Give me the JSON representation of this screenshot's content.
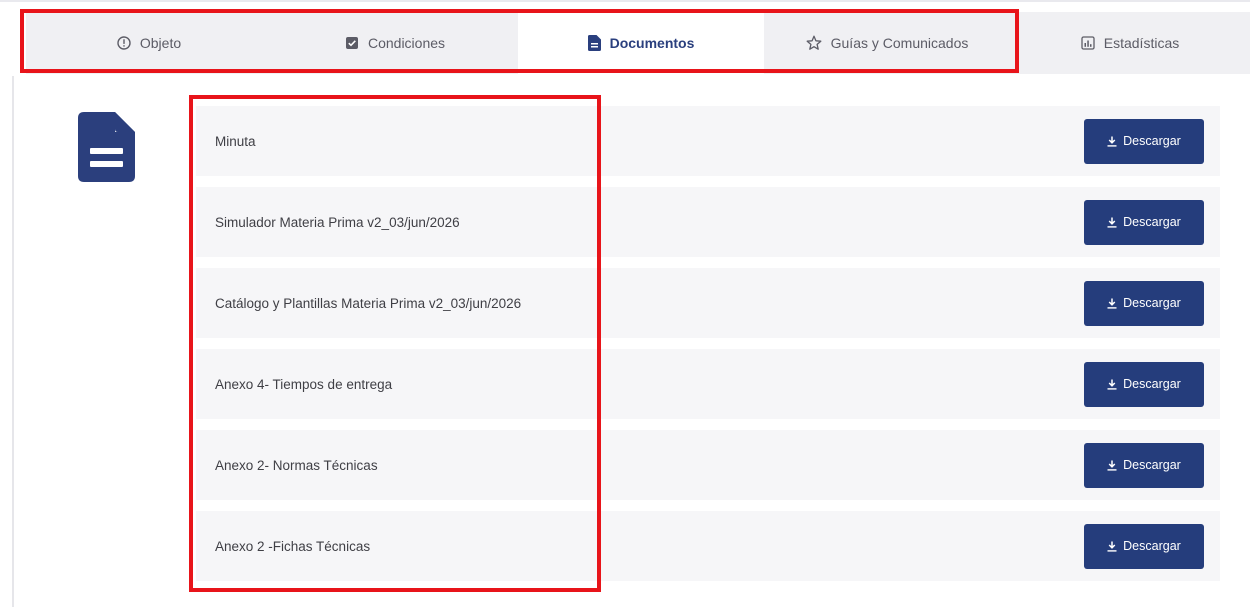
{
  "tabs": [
    {
      "label": "Objeto",
      "icon": "info-circle-icon",
      "active": false
    },
    {
      "label": "Condiciones",
      "icon": "checkbox-icon",
      "active": false
    },
    {
      "label": "Documentos",
      "icon": "document-icon",
      "active": true
    },
    {
      "label": "Guías y Comunicados",
      "icon": "star-icon",
      "active": false
    },
    {
      "label": "Estadísticas",
      "icon": "chart-icon",
      "active": false
    }
  ],
  "documents": [
    {
      "name": "Minuta",
      "button": "Descargar"
    },
    {
      "name": "Simulador Materia Prima v2_03/jun/2026",
      "button": "Descargar"
    },
    {
      "name": "Catálogo y Plantillas Materia Prima v2_03/jun/2026",
      "button": "Descargar"
    },
    {
      "name": "Anexo 4- Tiempos de entrega",
      "button": "Descargar"
    },
    {
      "name": "Anexo 2- Normas Técnicas",
      "button": "Descargar"
    },
    {
      "name": "Anexo 2 -Fichas Técnicas",
      "button": "Descargar"
    }
  ],
  "colors": {
    "accent": "#253d7c",
    "annotation": "#e8141a",
    "row_bg": "#f6f6f8"
  }
}
